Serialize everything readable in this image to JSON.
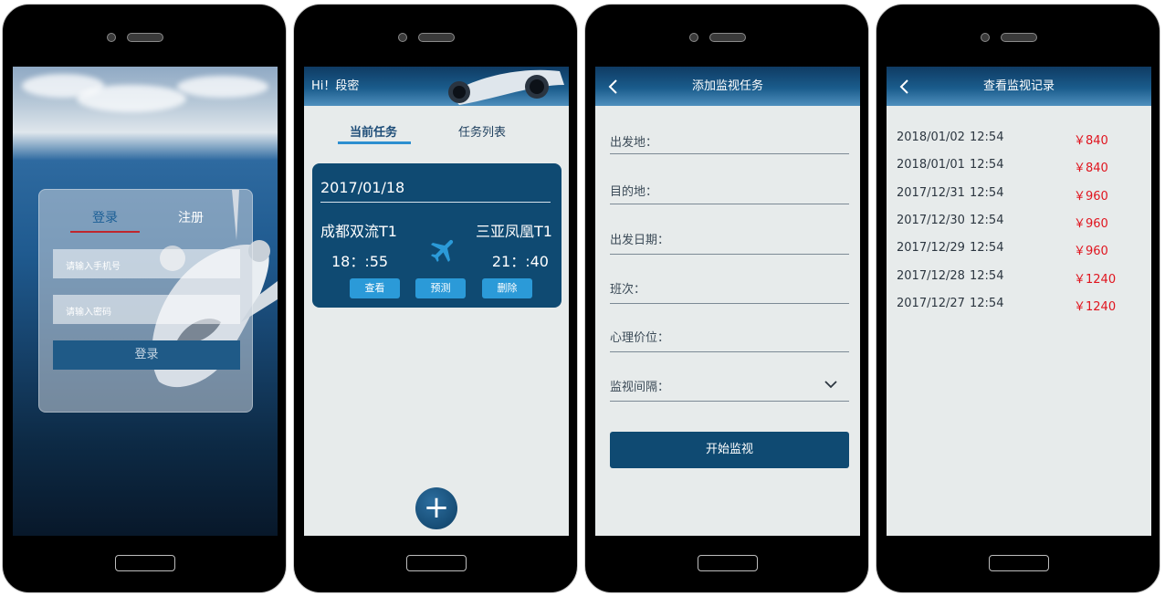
{
  "screen_login": {
    "tab_login": "登录",
    "tab_register": "注册",
    "phone_placeholder": "请输入手机号",
    "password_placeholder": "请输入密码",
    "login_button": "登录"
  },
  "screen_tasks": {
    "greeting": "Hi！段密",
    "tab_current": "当前任务",
    "tab_list": "任务列表",
    "card": {
      "date": "2017/01/18",
      "from": "成都双流T1",
      "to": "三亚凤凰T1",
      "depart_time": "18：:55",
      "arrive_time": "21：:40",
      "btn_view": "查看",
      "btn_predict": "预测",
      "btn_delete": "删除"
    },
    "add_button": "+"
  },
  "screen_add": {
    "title": "添加监视任务",
    "fields": [
      "出发地：",
      "目的地：",
      "出发日期：",
      "班次：",
      "心理价位：",
      "监视间隔："
    ],
    "start_button": "开始监视"
  },
  "screen_records": {
    "title": "查看监视记录",
    "records": [
      {
        "date": "2018/01/02",
        "time": "12:54",
        "price": "￥840"
      },
      {
        "date": "2018/01/01",
        "time": "12:54",
        "price": "￥840"
      },
      {
        "date": "2017/12/31",
        "time": "12:54",
        "price": "￥960"
      },
      {
        "date": "2017/12/30",
        "time": "12:54",
        "price": "￥960"
      },
      {
        "date": "2017/12/29",
        "time": "12:54",
        "price": "￥960"
      },
      {
        "date": "2017/12/28",
        "time": "12:54",
        "price": "￥1240"
      },
      {
        "date": "2017/12/27",
        "time": "12:54",
        "price": "￥1240"
      }
    ]
  },
  "colors": {
    "accent_blue": "#0f4a72",
    "tab_underline_red": "#c0272d",
    "button_blue": "#2b9ad8",
    "price_red": "#e0141e"
  }
}
